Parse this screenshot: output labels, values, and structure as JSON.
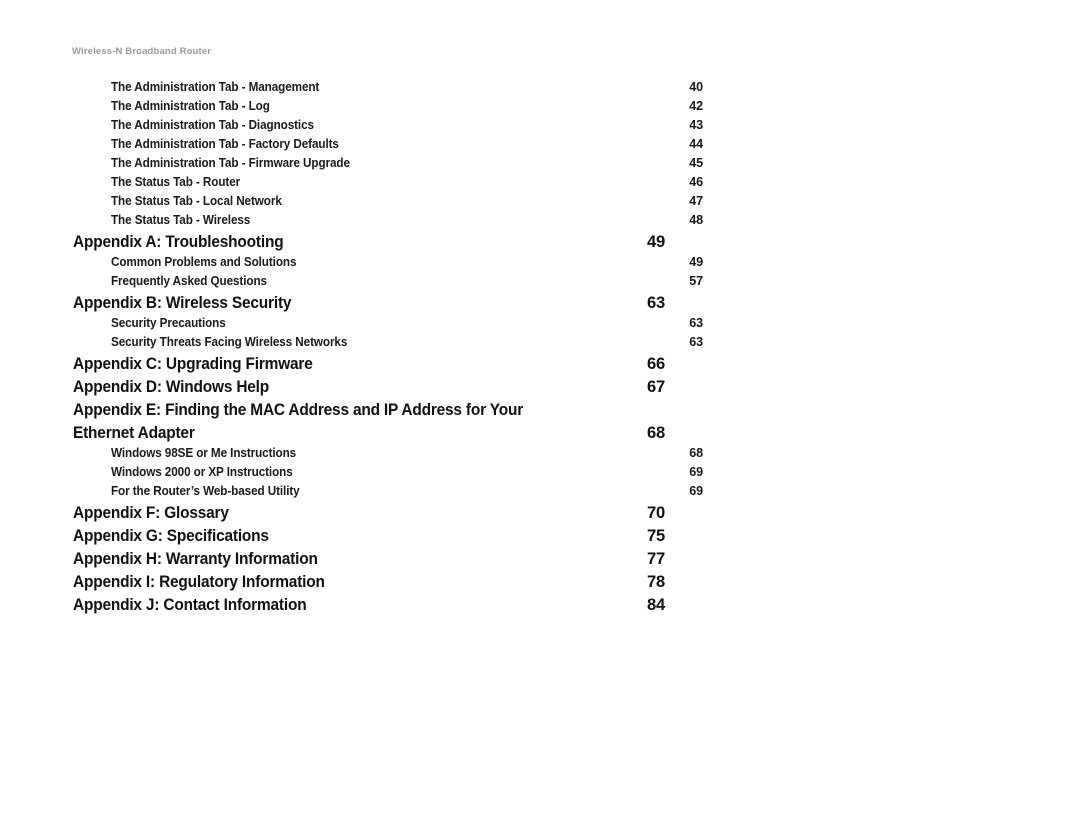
{
  "header": {
    "running_title": "Wireless-N Broadband Router"
  },
  "colors": {
    "page_background": "#ffffff",
    "header_text": "#9a9a9a",
    "heading_text": "#111111",
    "subentry_text": "#1a1a1a"
  },
  "toc": {
    "entries": [
      {
        "level": 2,
        "title": "The Administration Tab - Management",
        "page": "40"
      },
      {
        "level": 2,
        "title": "The Administration Tab - Log",
        "page": "42"
      },
      {
        "level": 2,
        "title": "The Administration Tab - Diagnostics",
        "page": "43"
      },
      {
        "level": 2,
        "title": "The Administration Tab - Factory Defaults",
        "page": "44"
      },
      {
        "level": 2,
        "title": "The Administration Tab - Firmware Upgrade",
        "page": "45"
      },
      {
        "level": 2,
        "title": "The Status Tab - Router",
        "page": "46"
      },
      {
        "level": 2,
        "title": "The Status Tab - Local Network",
        "page": "47"
      },
      {
        "level": 2,
        "title": "The Status Tab - Wireless",
        "page": "48"
      },
      {
        "level": 1,
        "title": "Appendix A: Troubleshooting",
        "page": "49"
      },
      {
        "level": 2,
        "title": "Common Problems and Solutions",
        "page": "49"
      },
      {
        "level": 2,
        "title": "Frequently Asked Questions",
        "page": "57"
      },
      {
        "level": 1,
        "title": "Appendix B: Wireless Security",
        "page": "63"
      },
      {
        "level": 2,
        "title": "Security Precautions",
        "page": "63"
      },
      {
        "level": 2,
        "title": "Security Threats Facing Wireless Networks",
        "page": "63"
      },
      {
        "level": 1,
        "title": "Appendix C: Upgrading Firmware",
        "page": "66"
      },
      {
        "level": 1,
        "title": "Appendix D: Windows Help",
        "page": "67"
      },
      {
        "level": 1,
        "title": "Appendix E: Finding the MAC Address and IP Address for Your",
        "page": ""
      },
      {
        "level": 1,
        "title": "Ethernet Adapter",
        "page": "68",
        "continuation": true
      },
      {
        "level": 2,
        "title": "Windows 98SE or Me Instructions",
        "page": "68"
      },
      {
        "level": 2,
        "title": "Windows 2000 or XP Instructions",
        "page": "69"
      },
      {
        "level": 2,
        "title": "For the Router’s Web-based Utility",
        "page": "69"
      },
      {
        "level": 1,
        "title": "Appendix F: Glossary",
        "page": "70"
      },
      {
        "level": 1,
        "title": "Appendix G: Specifications",
        "page": "75"
      },
      {
        "level": 1,
        "title": "Appendix H: Warranty Information",
        "page": "77"
      },
      {
        "level": 1,
        "title": "Appendix I: Regulatory Information",
        "page": "78"
      },
      {
        "level": 1,
        "title": "Appendix J: Contact Information",
        "page": "84"
      }
    ]
  }
}
